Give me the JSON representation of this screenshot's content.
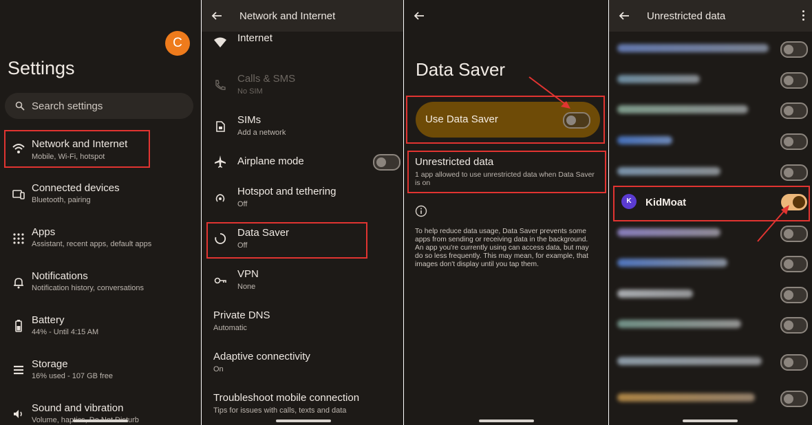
{
  "panel1": {
    "avatar_initial": "C",
    "title": "Settings",
    "search_placeholder": "Search settings",
    "items": [
      {
        "title": "Network and Internet",
        "subtitle": "Mobile, Wi-Fi, hotspot",
        "icon": "wifi-icon"
      },
      {
        "title": "Connected devices",
        "subtitle": "Bluetooth, pairing",
        "icon": "devices-icon"
      },
      {
        "title": "Apps",
        "subtitle": "Assistant, recent apps, default apps",
        "icon": "apps-grid-icon"
      },
      {
        "title": "Notifications",
        "subtitle": "Notification history, conversations",
        "icon": "bell-icon"
      },
      {
        "title": "Battery",
        "subtitle": "44% - Until 4:15 AM",
        "icon": "battery-icon"
      },
      {
        "title": "Storage",
        "subtitle": "16% used - 107 GB free",
        "icon": "storage-icon"
      },
      {
        "title": "Sound and vibration",
        "subtitle": "Volume, haptics, Do Not Disturb",
        "icon": "volume-icon"
      }
    ]
  },
  "panel2": {
    "title": "Network and Internet",
    "items": [
      {
        "title": "Internet",
        "subtitle": "",
        "icon": "wifi-icon"
      },
      {
        "title": "Calls & SMS",
        "subtitle": "No SIM",
        "icon": "calls-sms-icon"
      },
      {
        "title": "SIMs",
        "subtitle": "Add a network",
        "icon": "sim-icon"
      },
      {
        "title": "Airplane mode",
        "subtitle": "",
        "icon": "airplane-icon"
      },
      {
        "title": "Hotspot and tethering",
        "subtitle": "Off",
        "icon": "hotspot-icon"
      },
      {
        "title": "Data Saver",
        "subtitle": "Off",
        "icon": "data-saver-icon"
      },
      {
        "title": "VPN",
        "subtitle": "None",
        "icon": "vpn-key-icon"
      },
      {
        "title": "Private DNS",
        "subtitle": "Automatic"
      },
      {
        "title": "Adaptive connectivity",
        "subtitle": "On"
      },
      {
        "title": "Troubleshoot mobile connection",
        "subtitle": "Tips for issues with calls, texts and data"
      }
    ]
  },
  "panel3": {
    "title": "Data Saver",
    "toggle_label": "Use Data Saver",
    "unrestricted_title": "Unrestricted data",
    "unrestricted_subtitle": "1 app allowed to use unrestricted data when Data Saver is on",
    "description": "To help reduce data usage, Data Saver prevents some apps from sending or receiving data in the background. An app you're currently using can access data, but may do so less frequently. This may mean, for example, that images don't display until you tap them."
  },
  "panel4": {
    "title": "Unrestricted data",
    "app_name": "KidMoat",
    "app_icon_letter": "K"
  },
  "colors": {
    "background": "#1d1a17",
    "app_bar": "#2b2723",
    "highlight_box": "#e23431",
    "arrow": "#e23431",
    "data_saver_card": "#6e4b07",
    "toggle_on": "#ecb77a",
    "avatar": "#ee7b1c"
  }
}
